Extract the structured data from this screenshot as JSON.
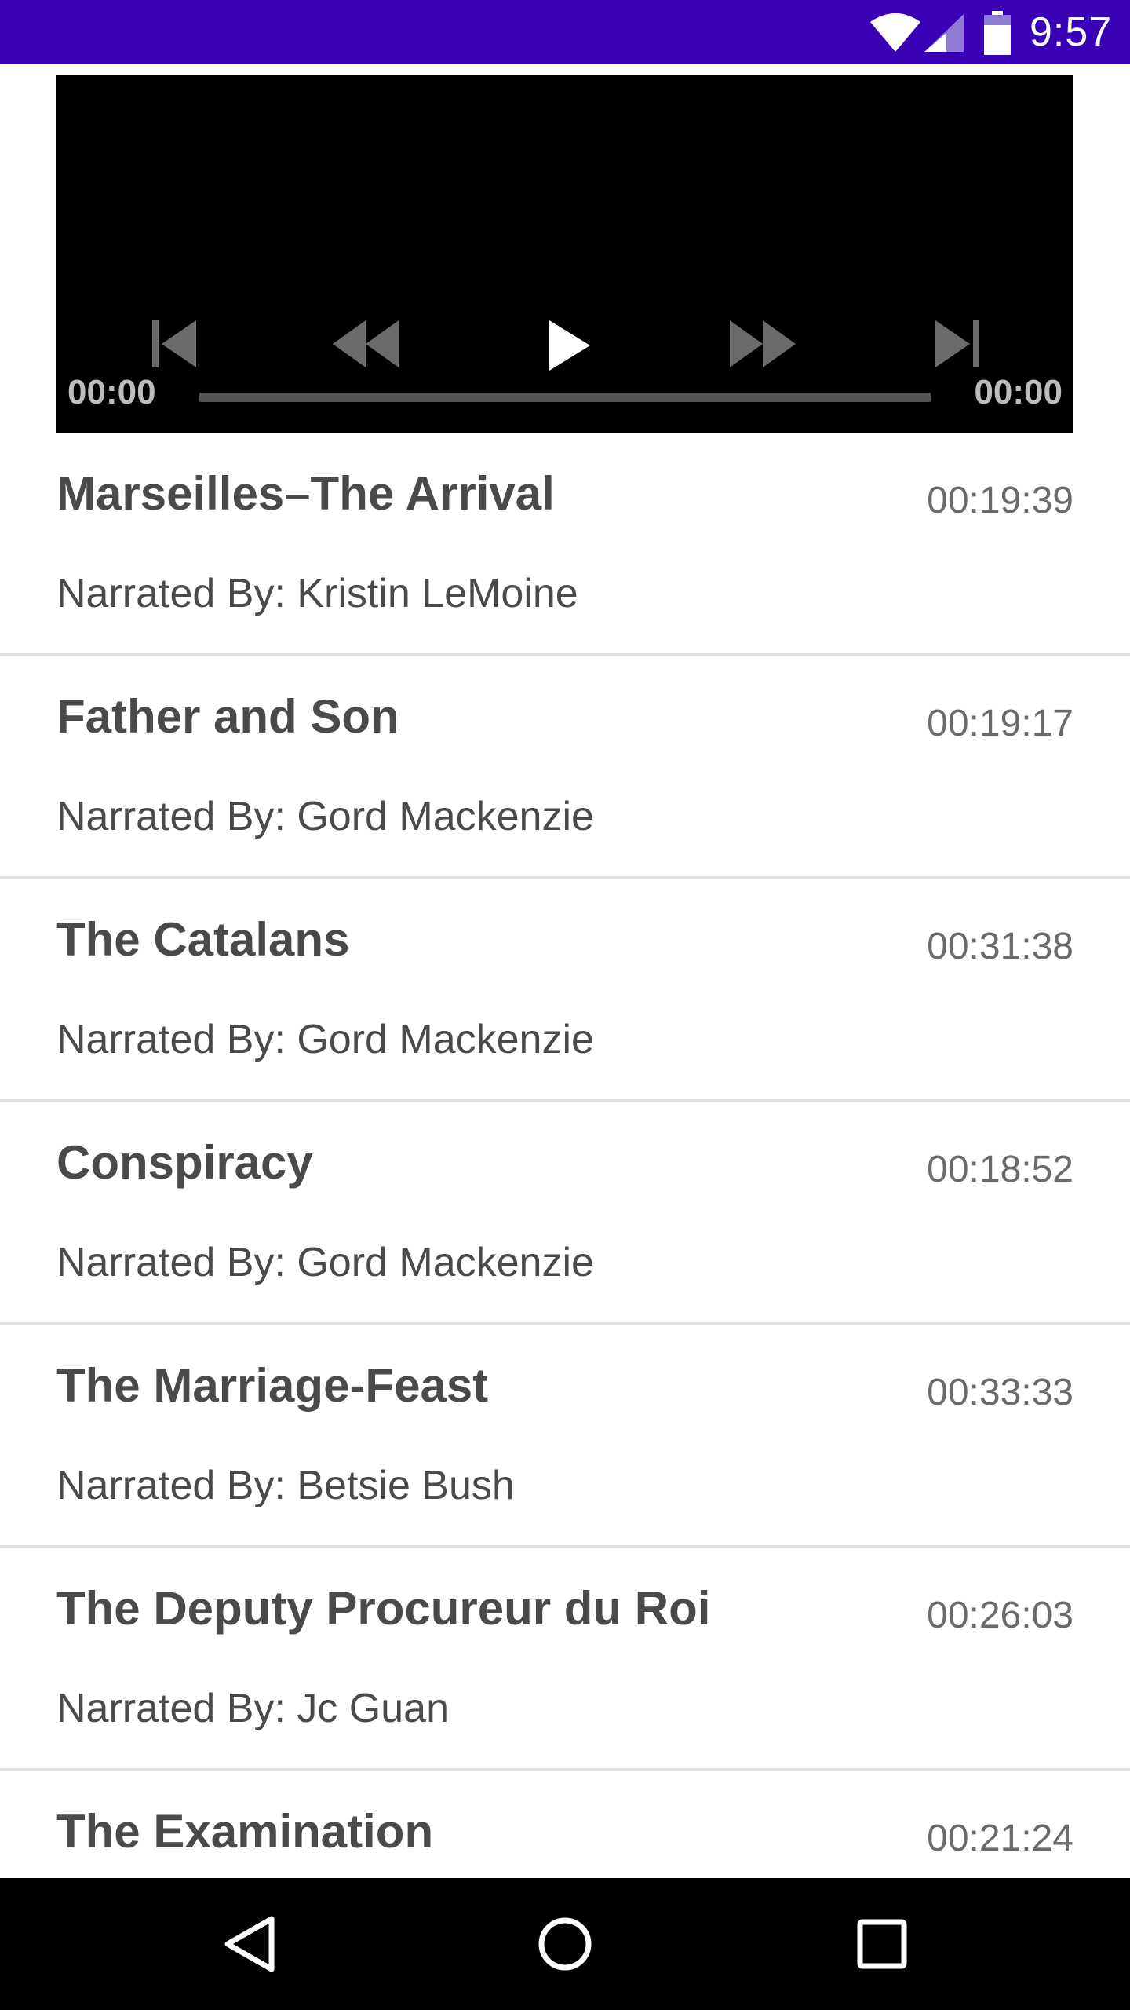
{
  "status_bar": {
    "time": "9:57",
    "icons": [
      "wifi-icon",
      "cell-signal-icon",
      "battery-icon"
    ],
    "background": "#3a00b5"
  },
  "player": {
    "current_time": "00:00",
    "total_time": "00:00",
    "progress": 0,
    "controls": [
      "skip-previous-icon",
      "rewind-icon",
      "play-icon",
      "fast-forward-icon",
      "skip-next-icon"
    ]
  },
  "chapters": [
    {
      "title": "Marseilles–The Arrival",
      "duration": "00:19:39",
      "narrator": "Narrated By: Kristin LeMoine"
    },
    {
      "title": "Father and Son",
      "duration": "00:19:17",
      "narrator": "Narrated By: Gord Mackenzie"
    },
    {
      "title": "The Catalans",
      "duration": "00:31:38",
      "narrator": "Narrated By: Gord Mackenzie"
    },
    {
      "title": "Conspiracy",
      "duration": "00:18:52",
      "narrator": "Narrated By: Gord Mackenzie"
    },
    {
      "title": "The Marriage-Feast",
      "duration": "00:33:33",
      "narrator": "Narrated By: Betsie Bush"
    },
    {
      "title": "The Deputy Procureur du Roi",
      "duration": "00:26:03",
      "narrator": "Narrated By: Jc Guan"
    },
    {
      "title": "The Examination",
      "duration": "00:21:24",
      "narrator": ""
    }
  ],
  "nav_bar": {
    "buttons": [
      "back-icon",
      "home-icon",
      "recents-icon"
    ]
  }
}
